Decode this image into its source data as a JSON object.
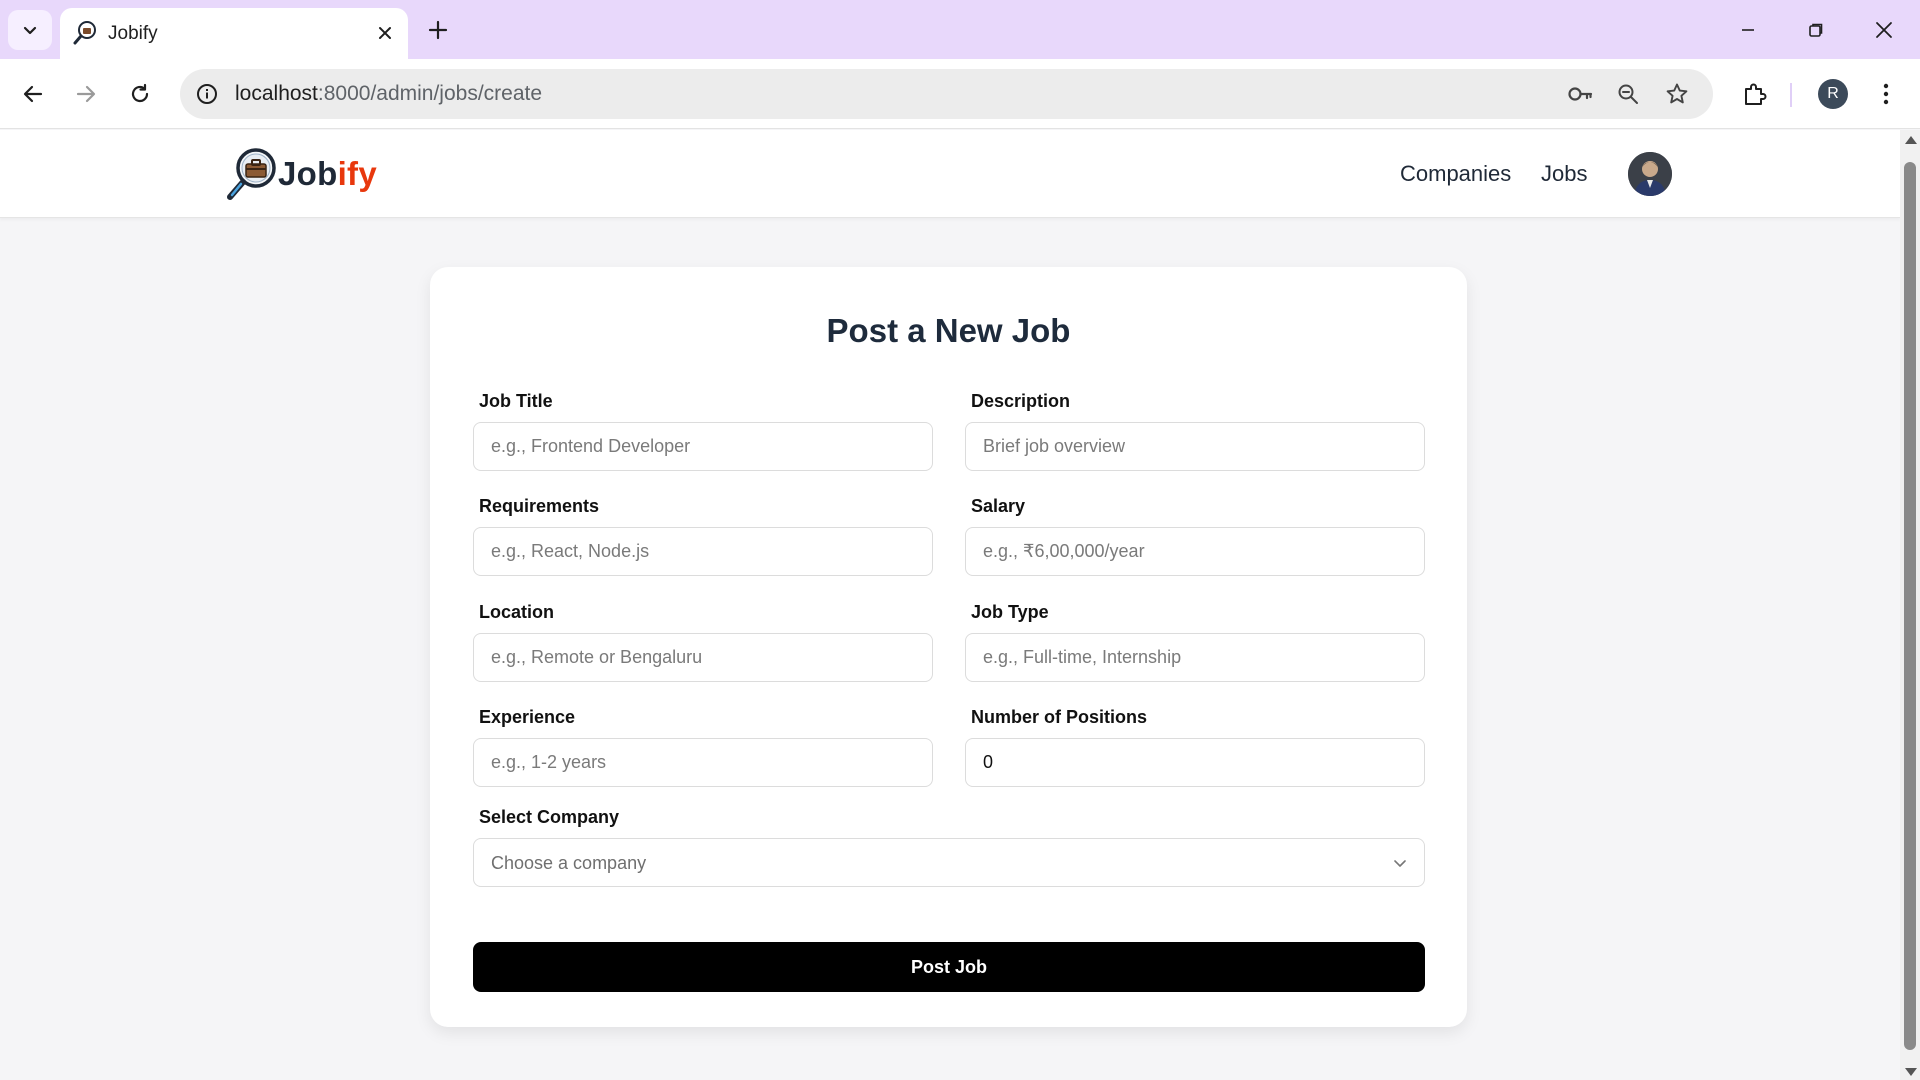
{
  "browser": {
    "tab": {
      "title": "Jobify",
      "favicon": "magnifier-briefcase-icon"
    },
    "url": {
      "host": "localhost",
      "path": ":8000/admin/jobs/create"
    },
    "profile_initial": "R",
    "icons": [
      "tab-list-icon",
      "close-icon",
      "new-tab-icon",
      "minimize-icon",
      "restore-icon",
      "window-close-icon",
      "back-icon",
      "forward-icon",
      "reload-icon",
      "site-info-icon",
      "password-key-icon",
      "zoom-icon",
      "bookmark-star-icon",
      "extensions-icon",
      "kebab-menu-icon"
    ]
  },
  "site": {
    "logo": {
      "part1": "Job",
      "part2": "ify"
    },
    "nav": {
      "companies": "Companies",
      "jobs": "Jobs"
    }
  },
  "form": {
    "title": "Post a New Job",
    "fields": {
      "job_title": {
        "label": "Job Title",
        "placeholder": "e.g., Frontend Developer",
        "value": ""
      },
      "description": {
        "label": "Description",
        "placeholder": "Brief job overview",
        "value": ""
      },
      "requirements": {
        "label": "Requirements",
        "placeholder": "e.g., React, Node.js",
        "value": ""
      },
      "salary": {
        "label": "Salary",
        "placeholder": "e.g., ₹6,00,000/year",
        "value": ""
      },
      "location": {
        "label": "Location",
        "placeholder": "e.g., Remote or Bengaluru",
        "value": ""
      },
      "job_type": {
        "label": "Job Type",
        "placeholder": "e.g., Full-time, Internship",
        "value": ""
      },
      "experience": {
        "label": "Experience",
        "placeholder": "e.g., 1-2 years",
        "value": ""
      },
      "positions": {
        "label": "Number of Positions",
        "placeholder": "",
        "value": "0"
      }
    },
    "company": {
      "label": "Select Company",
      "selected": "Choose a company"
    },
    "submit_label": "Post Job"
  },
  "colors": {
    "tabstrip": "#e8d8fb",
    "logo_accent": "#e8380d",
    "title": "#1e2b3c",
    "button": "#000000"
  }
}
